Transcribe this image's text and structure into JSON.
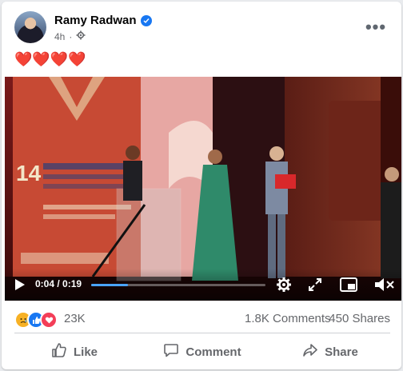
{
  "post": {
    "author": "Ramy Radwan",
    "time": "4h",
    "text": "❤️❤️❤️❤️"
  },
  "video": {
    "current_time": "0:04",
    "duration": "0:19",
    "progress_fraction": 0.21,
    "banner_number": "14"
  },
  "stats": {
    "reactions_count": "23K",
    "comments": "1.8K Comments",
    "shares": "450 Shares"
  },
  "actions": {
    "like": "Like",
    "comment": "Comment",
    "share": "Share"
  },
  "colors": {
    "accent": "#1877f2",
    "love": "#f33e58",
    "sad": "#f7b125"
  }
}
